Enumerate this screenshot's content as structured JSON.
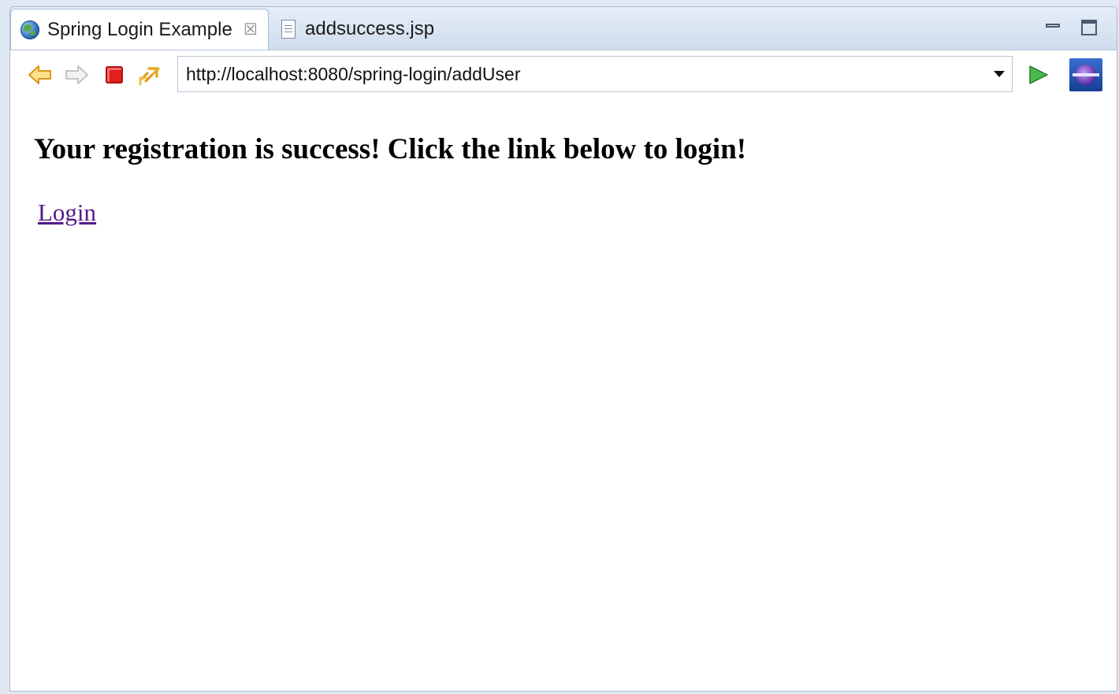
{
  "tabs": [
    {
      "label": "Spring Login Example",
      "icon": "globe-icon",
      "close_glyph": "☒"
    },
    {
      "label": "addsuccess.jsp",
      "icon": "jsp-file-icon"
    }
  ],
  "toolbar": {
    "url": "http://localhost:8080/spring-login/addUser"
  },
  "page": {
    "heading": "Your registration is success! Click the link below to login!",
    "link_label": "Login",
    "link_color": "#551a8b"
  },
  "colors": {
    "tabbar_bg": "#cfdcec",
    "stop": "#e0201f",
    "back_arrow": "#f0b429",
    "go": "#3aa83a"
  }
}
